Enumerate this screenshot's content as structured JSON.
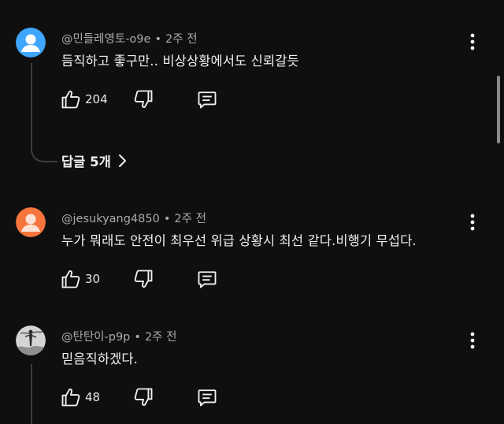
{
  "comments": [
    {
      "author": "@민들레영토-o9e",
      "time": "2주 전",
      "text": "듬직하고 좋구만.. 비상상황에서도 신뢰갈듯",
      "likes": "204",
      "avatar_color": "#3ea6ff",
      "avatar_icon": "default-person-icon"
    },
    {
      "author": "@jesukyang4850",
      "time": "2주 전",
      "text": "누가 뭐래도 안전이 최우선 위급 상황시 최선 같다.비행기 무섭다.",
      "likes": "30",
      "avatar_color": "#f5753d",
      "avatar_icon": "default-person-icon"
    },
    {
      "author": "@탄탄이-p9p",
      "time": "2주 전",
      "text": "믿음직하겠다.",
      "likes": "48",
      "avatar_color": "#cfcfcf",
      "avatar_icon": "photo-avatar"
    }
  ],
  "replies": {
    "label": "답글 5개"
  },
  "separator": "•",
  "colors": {
    "background": "#0f0f0f",
    "primary_text": "#f1f1f1",
    "secondary_text": "#aaaaaa",
    "thread_line": "#3d3d3d"
  }
}
